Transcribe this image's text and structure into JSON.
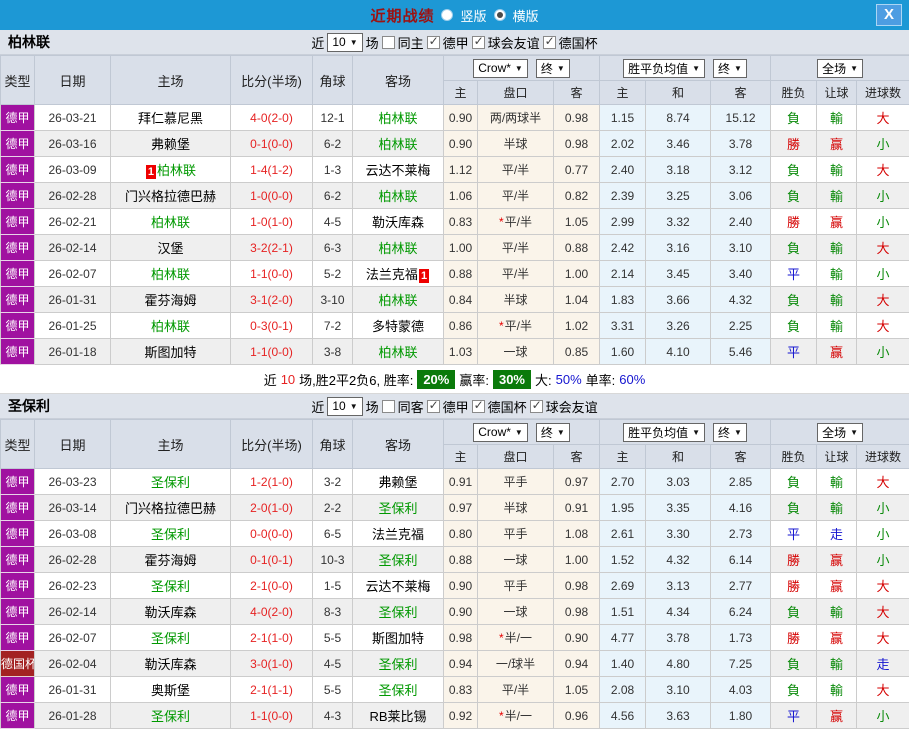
{
  "titlebar": {
    "title": "近期战绩",
    "layout_options": [
      {
        "label": "竖版",
        "selected": false
      },
      {
        "label": "横版",
        "selected": true
      }
    ],
    "close_label": "X"
  },
  "table": {
    "main_columns": [
      "类型",
      "日期",
      "主场",
      "比分(半场)",
      "角球",
      "客场"
    ],
    "sub_columns": [
      "主",
      "盘口",
      "客",
      "主",
      "和",
      "客",
      "胜负",
      "让球",
      "进球数"
    ]
  },
  "colors": {
    "topbar": "#1d98d5",
    "league_badge": "#a011a0",
    "cup_badge": "#a32222",
    "focal_team": "#009900",
    "outcome": {
      "r": "#d50000",
      "g": "#0a8a0a",
      "b": "#1515d0"
    }
  },
  "sections": [
    {
      "team": "柏林联",
      "filters": {
        "near": "近",
        "count": "10",
        "unit": "场",
        "toggle": {
          "label": "同主",
          "checked": false
        },
        "leagues": [
          {
            "label": "德甲",
            "checked": true
          },
          {
            "label": "球会友谊",
            "checked": true
          },
          {
            "label": "德国杯",
            "checked": true
          }
        ]
      },
      "dropdowns": {
        "bookmaker": "Crow*",
        "asian_period": "终",
        "europe": "胜平负均值",
        "europe_period": "终",
        "scope": "全场"
      },
      "rows": [
        {
          "type": "德甲",
          "tc": "league",
          "date": "26-03-21",
          "home": {
            "name": "拜仁慕尼黑"
          },
          "score": "4-0",
          "half": "(2-0)",
          "corner": "12-1",
          "away": {
            "name": "柏林联",
            "focal": true
          },
          "asian": [
            "0.90",
            "两/两球半",
            "0.98"
          ],
          "euro": [
            "1.15",
            "8.74",
            "15.12"
          ],
          "res": [
            [
              "負",
              "g"
            ],
            [
              "輸",
              "g"
            ],
            [
              "大",
              "r"
            ]
          ]
        },
        {
          "type": "德甲",
          "tc": "league",
          "date": "26-03-16",
          "home": {
            "name": "弗赖堡"
          },
          "score": "0-1",
          "half": "(0-0)",
          "corner": "6-2",
          "away": {
            "name": "柏林联",
            "focal": true
          },
          "asian": [
            "0.90",
            "半球",
            "0.98"
          ],
          "euro": [
            "2.02",
            "3.46",
            "3.78"
          ],
          "res": [
            [
              "勝",
              "r"
            ],
            [
              "赢",
              "r"
            ],
            [
              "小",
              "g"
            ]
          ]
        },
        {
          "type": "德甲",
          "tc": "league",
          "date": "26-03-09",
          "home": {
            "name": "柏林联",
            "focal": true,
            "rank": "1",
            "badge": "before"
          },
          "score": "1-4",
          "half": "(1-2)",
          "corner": "1-3",
          "away": {
            "name": "云达不莱梅"
          },
          "asian": [
            "1.12",
            "平/半",
            "0.77"
          ],
          "euro": [
            "2.40",
            "3.18",
            "3.12"
          ],
          "res": [
            [
              "負",
              "g"
            ],
            [
              "輸",
              "g"
            ],
            [
              "大",
              "r"
            ]
          ]
        },
        {
          "type": "德甲",
          "tc": "league",
          "date": "26-02-28",
          "home": {
            "name": "门兴格拉德巴赫"
          },
          "score": "1-0",
          "half": "(0-0)",
          "corner": "6-2",
          "away": {
            "name": "柏林联",
            "focal": true
          },
          "asian": [
            "1.06",
            "平/半",
            "0.82"
          ],
          "euro": [
            "2.39",
            "3.25",
            "3.06"
          ],
          "res": [
            [
              "負",
              "g"
            ],
            [
              "輸",
              "g"
            ],
            [
              "小",
              "g"
            ]
          ]
        },
        {
          "type": "德甲",
          "tc": "league",
          "date": "26-02-21",
          "home": {
            "name": "柏林联",
            "focal": true
          },
          "score": "1-0",
          "half": "(1-0)",
          "corner": "4-5",
          "away": {
            "name": "勒沃库森"
          },
          "asian": [
            "0.83",
            "*平/半",
            "1.05"
          ],
          "euro": [
            "2.99",
            "3.32",
            "2.40"
          ],
          "res": [
            [
              "勝",
              "r"
            ],
            [
              "赢",
              "r"
            ],
            [
              "小",
              "g"
            ]
          ]
        },
        {
          "type": "德甲",
          "tc": "league",
          "date": "26-02-14",
          "home": {
            "name": "汉堡"
          },
          "score": "3-2",
          "half": "(2-1)",
          "corner": "6-3",
          "away": {
            "name": "柏林联",
            "focal": true
          },
          "asian": [
            "1.00",
            "平/半",
            "0.88"
          ],
          "euro": [
            "2.42",
            "3.16",
            "3.10"
          ],
          "res": [
            [
              "負",
              "g"
            ],
            [
              "輸",
              "g"
            ],
            [
              "大",
              "r"
            ]
          ]
        },
        {
          "type": "德甲",
          "tc": "league",
          "date": "26-02-07",
          "home": {
            "name": "柏林联",
            "focal": true
          },
          "score": "1-1",
          "half": "(0-0)",
          "corner": "5-2",
          "away": {
            "name": "法兰克福",
            "rank": "1",
            "badge": "after"
          },
          "asian": [
            "0.88",
            "平/半",
            "1.00"
          ],
          "euro": [
            "2.14",
            "3.45",
            "3.40"
          ],
          "res": [
            [
              "平",
              "b"
            ],
            [
              "輸",
              "g"
            ],
            [
              "小",
              "g"
            ]
          ]
        },
        {
          "type": "德甲",
          "tc": "league",
          "date": "26-01-31",
          "home": {
            "name": "霍芬海姆"
          },
          "score": "3-1",
          "half": "(2-0)",
          "corner": "3-10",
          "away": {
            "name": "柏林联",
            "focal": true
          },
          "asian": [
            "0.84",
            "半球",
            "1.04"
          ],
          "euro": [
            "1.83",
            "3.66",
            "4.32"
          ],
          "res": [
            [
              "負",
              "g"
            ],
            [
              "輸",
              "g"
            ],
            [
              "大",
              "r"
            ]
          ]
        },
        {
          "type": "德甲",
          "tc": "league",
          "date": "26-01-25",
          "home": {
            "name": "柏林联",
            "focal": true
          },
          "score": "0-3",
          "half": "(0-1)",
          "corner": "7-2",
          "away": {
            "name": "多特蒙德"
          },
          "asian": [
            "0.86",
            "*平/半",
            "1.02"
          ],
          "euro": [
            "3.31",
            "3.26",
            "2.25"
          ],
          "res": [
            [
              "負",
              "g"
            ],
            [
              "輸",
              "g"
            ],
            [
              "大",
              "r"
            ]
          ]
        },
        {
          "type": "德甲",
          "tc": "league",
          "date": "26-01-18",
          "home": {
            "name": "斯图加特"
          },
          "score": "1-1",
          "half": "(0-0)",
          "corner": "3-8",
          "away": {
            "name": "柏林联",
            "focal": true
          },
          "asian": [
            "1.03",
            "一球",
            "0.85"
          ],
          "euro": [
            "1.60",
            "4.10",
            "5.46"
          ],
          "res": [
            [
              "平",
              "b"
            ],
            [
              "赢",
              "r"
            ],
            [
              "小",
              "g"
            ]
          ]
        }
      ],
      "summary": {
        "t1": "近",
        "count": "10",
        "t2": "场,胜2平2负6, 胜率:",
        "win_rate": "20%",
        "t3": "赢率:",
        "handicap_rate": "30%",
        "t4": "大:",
        "big_rate": "50%",
        "t5": "单率:",
        "single_rate": "60%"
      }
    },
    {
      "team": "圣保利",
      "filters": {
        "near": "近",
        "count": "10",
        "unit": "场",
        "toggle": {
          "label": "同客",
          "checked": false
        },
        "leagues": [
          {
            "label": "德甲",
            "checked": true
          },
          {
            "label": "德国杯",
            "checked": true
          },
          {
            "label": "球会友谊",
            "checked": true
          }
        ]
      },
      "dropdowns": {
        "bookmaker": "Crow*",
        "asian_period": "终",
        "europe": "胜平负均值",
        "europe_period": "终",
        "scope": "全场"
      },
      "rows": [
        {
          "type": "德甲",
          "tc": "league",
          "date": "26-03-23",
          "home": {
            "name": "圣保利",
            "focal": true
          },
          "score": "1-2",
          "half": "(1-0)",
          "corner": "3-2",
          "away": {
            "name": "弗赖堡"
          },
          "asian": [
            "0.91",
            "平手",
            "0.97"
          ],
          "euro": [
            "2.70",
            "3.03",
            "2.85"
          ],
          "res": [
            [
              "負",
              "g"
            ],
            [
              "輸",
              "g"
            ],
            [
              "大",
              "r"
            ]
          ]
        },
        {
          "type": "德甲",
          "tc": "league",
          "date": "26-03-14",
          "home": {
            "name": "门兴格拉德巴赫"
          },
          "score": "2-0",
          "half": "(1-0)",
          "corner": "2-2",
          "away": {
            "name": "圣保利",
            "focal": true
          },
          "asian": [
            "0.97",
            "半球",
            "0.91"
          ],
          "euro": [
            "1.95",
            "3.35",
            "4.16"
          ],
          "res": [
            [
              "負",
              "g"
            ],
            [
              "輸",
              "g"
            ],
            [
              "小",
              "g"
            ]
          ]
        },
        {
          "type": "德甲",
          "tc": "league",
          "date": "26-03-08",
          "home": {
            "name": "圣保利",
            "focal": true
          },
          "score": "0-0",
          "half": "(0-0)",
          "corner": "6-5",
          "away": {
            "name": "法兰克福"
          },
          "asian": [
            "0.80",
            "平手",
            "1.08"
          ],
          "euro": [
            "2.61",
            "3.30",
            "2.73"
          ],
          "res": [
            [
              "平",
              "b"
            ],
            [
              "走",
              "b"
            ],
            [
              "小",
              "g"
            ]
          ]
        },
        {
          "type": "德甲",
          "tc": "league",
          "date": "26-02-28",
          "home": {
            "name": "霍芬海姆"
          },
          "score": "0-1",
          "half": "(0-1)",
          "corner": "10-3",
          "away": {
            "name": "圣保利",
            "focal": true
          },
          "asian": [
            "0.88",
            "一球",
            "1.00"
          ],
          "euro": [
            "1.52",
            "4.32",
            "6.14"
          ],
          "res": [
            [
              "勝",
              "r"
            ],
            [
              "赢",
              "r"
            ],
            [
              "小",
              "g"
            ]
          ]
        },
        {
          "type": "德甲",
          "tc": "league",
          "date": "26-02-23",
          "home": {
            "name": "圣保利",
            "focal": true
          },
          "score": "2-1",
          "half": "(0-0)",
          "corner": "1-5",
          "away": {
            "name": "云达不莱梅"
          },
          "asian": [
            "0.90",
            "平手",
            "0.98"
          ],
          "euro": [
            "2.69",
            "3.13",
            "2.77"
          ],
          "res": [
            [
              "勝",
              "r"
            ],
            [
              "赢",
              "r"
            ],
            [
              "大",
              "r"
            ]
          ]
        },
        {
          "type": "德甲",
          "tc": "league",
          "date": "26-02-14",
          "home": {
            "name": "勒沃库森"
          },
          "score": "4-0",
          "half": "(2-0)",
          "corner": "8-3",
          "away": {
            "name": "圣保利",
            "focal": true
          },
          "asian": [
            "0.90",
            "一球",
            "0.98"
          ],
          "euro": [
            "1.51",
            "4.34",
            "6.24"
          ],
          "res": [
            [
              "負",
              "g"
            ],
            [
              "輸",
              "g"
            ],
            [
              "大",
              "r"
            ]
          ]
        },
        {
          "type": "德甲",
          "tc": "league",
          "date": "26-02-07",
          "home": {
            "name": "圣保利",
            "focal": true
          },
          "score": "2-1",
          "half": "(1-0)",
          "corner": "5-5",
          "away": {
            "name": "斯图加特"
          },
          "asian": [
            "0.98",
            "*半/一",
            "0.90"
          ],
          "euro": [
            "4.77",
            "3.78",
            "1.73"
          ],
          "res": [
            [
              "勝",
              "r"
            ],
            [
              "赢",
              "r"
            ],
            [
              "大",
              "r"
            ]
          ]
        },
        {
          "type": "德国杯",
          "tc": "cup",
          "date": "26-02-04",
          "home": {
            "name": "勒沃库森"
          },
          "score": "3-0",
          "half": "(1-0)",
          "corner": "4-5",
          "away": {
            "name": "圣保利",
            "focal": true
          },
          "asian": [
            "0.94",
            "一/球半",
            "0.94"
          ],
          "euro": [
            "1.40",
            "4.80",
            "7.25"
          ],
          "res": [
            [
              "負",
              "g"
            ],
            [
              "輸",
              "g"
            ],
            [
              "走",
              "b"
            ]
          ]
        },
        {
          "type": "德甲",
          "tc": "league",
          "date": "26-01-31",
          "home": {
            "name": "奥斯堡"
          },
          "score": "2-1",
          "half": "(1-1)",
          "corner": "5-5",
          "away": {
            "name": "圣保利",
            "focal": true
          },
          "asian": [
            "0.83",
            "平/半",
            "1.05"
          ],
          "euro": [
            "2.08",
            "3.10",
            "4.03"
          ],
          "res": [
            [
              "負",
              "g"
            ],
            [
              "輸",
              "g"
            ],
            [
              "大",
              "r"
            ]
          ]
        },
        {
          "type": "德甲",
          "tc": "league",
          "date": "26-01-28",
          "home": {
            "name": "圣保利",
            "focal": true
          },
          "score": "1-1",
          "half": "(0-0)",
          "corner": "4-3",
          "away": {
            "name": "RB莱比锡"
          },
          "asian": [
            "0.92",
            "*半/一",
            "0.96"
          ],
          "euro": [
            "4.56",
            "3.63",
            "1.80"
          ],
          "res": [
            [
              "平",
              "b"
            ],
            [
              "赢",
              "r"
            ],
            [
              "小",
              "g"
            ]
          ]
        }
      ]
    }
  ]
}
